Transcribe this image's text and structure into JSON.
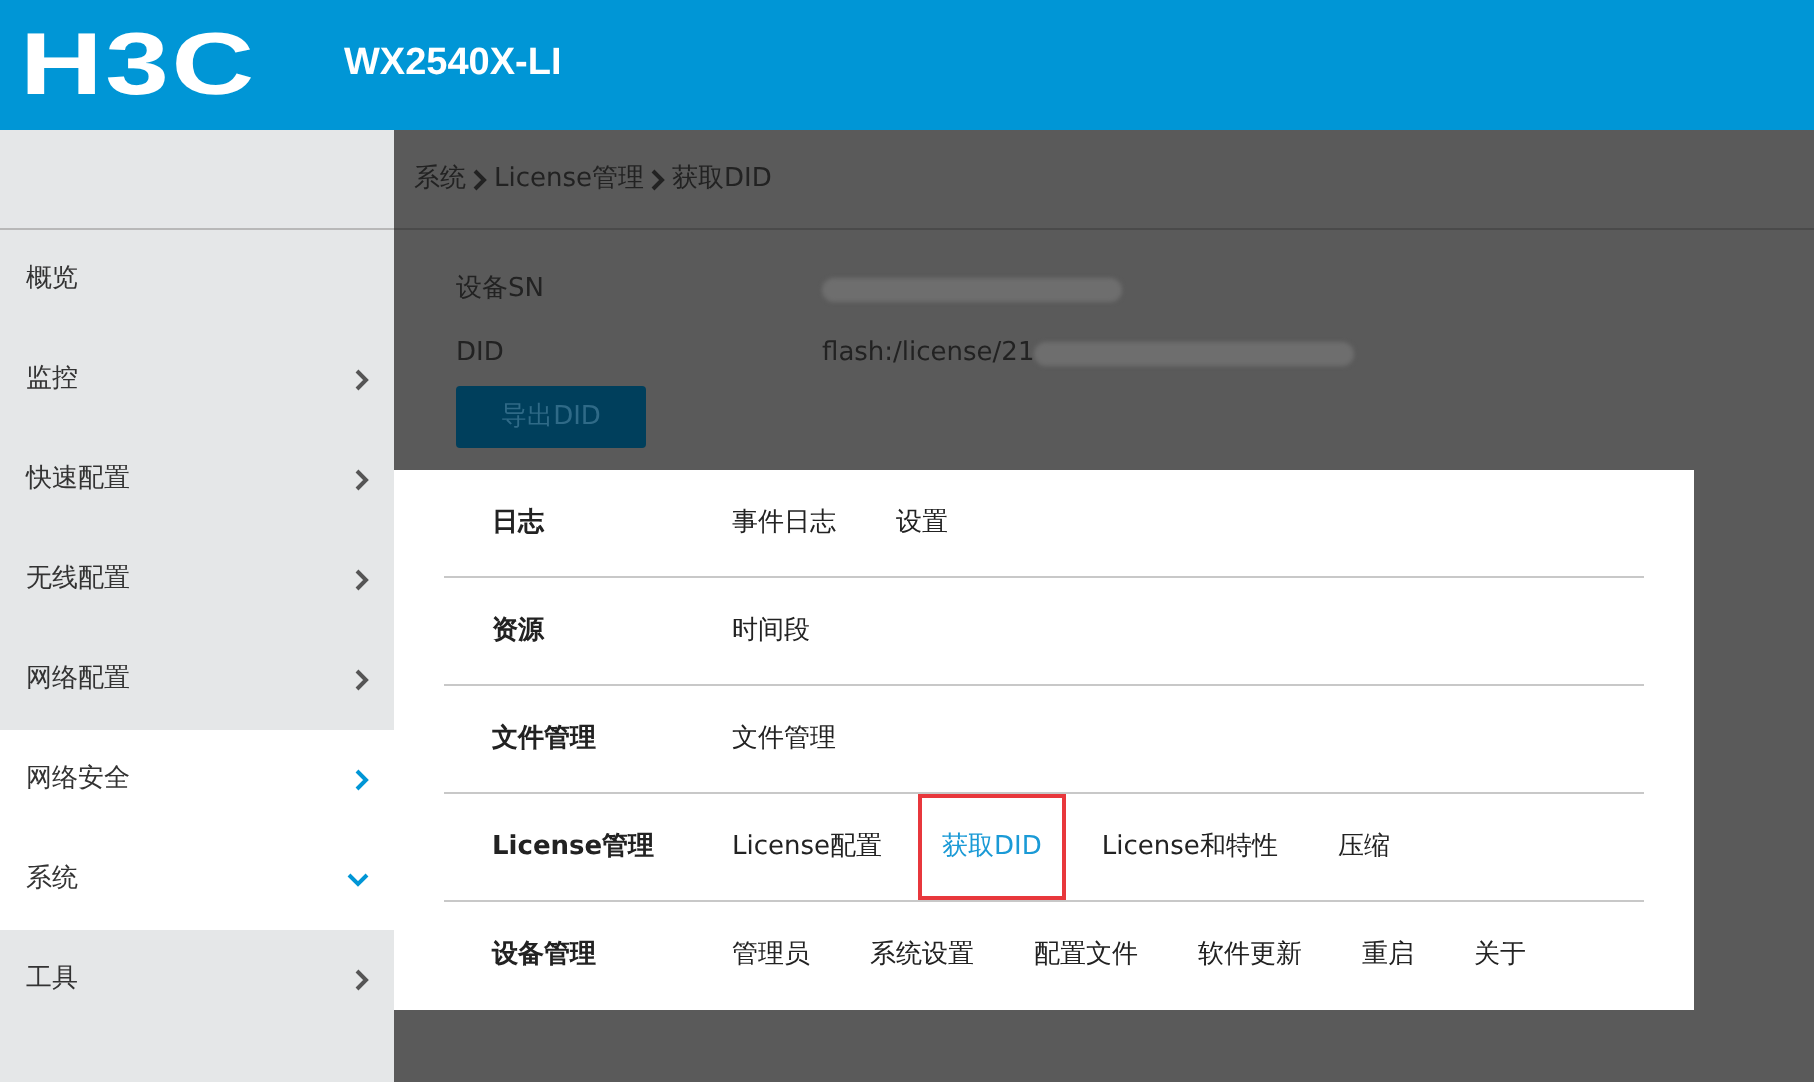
{
  "header": {
    "logo": "H3C",
    "model": "WX2540X-LI"
  },
  "sidebar": {
    "items": [
      {
        "label": "概览",
        "kind": "none",
        "highlighted": false
      },
      {
        "label": "监控",
        "kind": "right",
        "highlighted": false
      },
      {
        "label": "快速配置",
        "kind": "right",
        "highlighted": false
      },
      {
        "label": "无线配置",
        "kind": "right",
        "highlighted": false
      },
      {
        "label": "网络配置",
        "kind": "right",
        "highlighted": false
      },
      {
        "label": "网络安全",
        "kind": "right",
        "highlighted": true
      },
      {
        "label": "系统",
        "kind": "down",
        "highlighted": true
      },
      {
        "label": "工具",
        "kind": "right",
        "highlighted": false
      }
    ]
  },
  "breadcrumb": [
    "系统",
    "License管理",
    "获取DID"
  ],
  "fields": [
    {
      "label": "设备SN",
      "redacted": true
    },
    {
      "label": "DID",
      "value": "flash:/license/21",
      "redacted": true
    }
  ],
  "export_button": "导出DID",
  "menu": {
    "groups": [
      {
        "label": "日志",
        "items": [
          {
            "label": "事件日志",
            "selected": false,
            "annotated": false
          },
          {
            "label": "设置",
            "selected": false,
            "annotated": false
          }
        ]
      },
      {
        "label": "资源",
        "items": [
          {
            "label": "时间段",
            "selected": false,
            "annotated": false
          }
        ]
      },
      {
        "label": "文件管理",
        "items": [
          {
            "label": "文件管理",
            "selected": false,
            "annotated": false
          }
        ]
      },
      {
        "label": "License管理",
        "items": [
          {
            "label": "License配置",
            "selected": false,
            "annotated": false
          },
          {
            "label": "获取DID",
            "selected": true,
            "annotated": true
          },
          {
            "label": "License和特性",
            "selected": false,
            "annotated": false
          },
          {
            "label": "压缩",
            "selected": false,
            "annotated": false
          }
        ]
      },
      {
        "label": "设备管理",
        "items": [
          {
            "label": "管理员",
            "selected": false,
            "annotated": false
          },
          {
            "label": "系统设置",
            "selected": false,
            "annotated": false
          },
          {
            "label": "配置文件",
            "selected": false,
            "annotated": false
          },
          {
            "label": "软件更新",
            "selected": false,
            "annotated": false
          },
          {
            "label": "重启",
            "selected": false,
            "annotated": false
          },
          {
            "label": "关于",
            "selected": false,
            "annotated": false
          }
        ]
      }
    ]
  }
}
